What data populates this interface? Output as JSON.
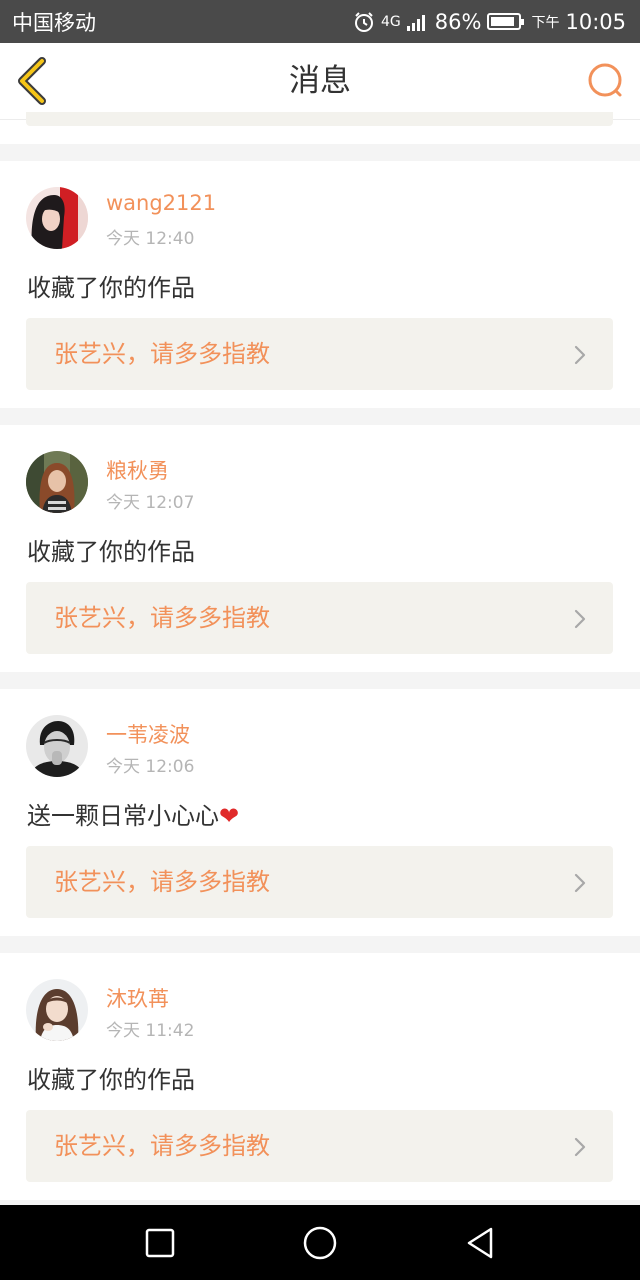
{
  "status_bar": {
    "carrier": "中国移动",
    "network": "4G",
    "battery": "86%",
    "battery_level": 0.86,
    "time_prefix": "下午",
    "time": "10:05",
    "icons": [
      "alarm-icon",
      "signal-icon",
      "battery-icon"
    ]
  },
  "header": {
    "title": "消息",
    "back_icon": "chevron-left-icon",
    "search_icon": "search-icon",
    "accent": "#f2915a"
  },
  "messages": [
    {
      "username": "wang2121",
      "time": "今天 12:40",
      "action": "收藏了你的作品",
      "work_title": "张艺兴，请多多指教"
    },
    {
      "username": "粮秋勇",
      "time": "今天 12:07",
      "action": "收藏了你的作品",
      "work_title": "张艺兴，请多多指教"
    },
    {
      "username": "一苇凌波",
      "time": "今天 12:06",
      "action": "送一颗日常小心心",
      "action_emoji": "❤",
      "work_title": "张艺兴，请多多指教"
    },
    {
      "username": "沐玖苒",
      "time": "今天 11:42",
      "action": "收藏了你的作品",
      "work_title": "张艺兴，请多多指教"
    }
  ],
  "nav_bar": {
    "icons": [
      "recents-square-icon",
      "home-circle-icon",
      "back-triangle-icon"
    ]
  }
}
